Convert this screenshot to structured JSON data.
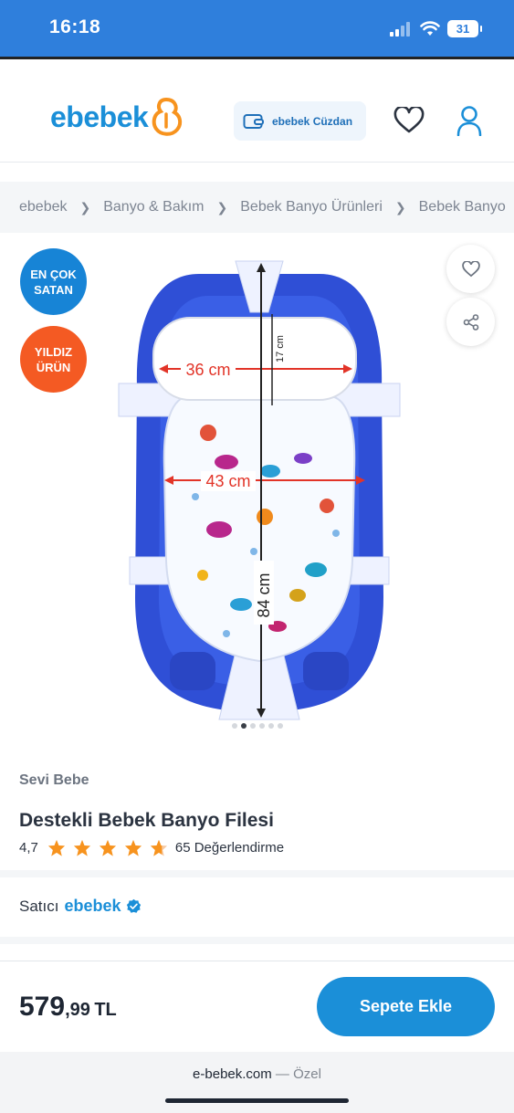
{
  "status": {
    "time": "16:18",
    "battery": "31"
  },
  "header": {
    "logo_text": "ebebek",
    "wallet_label": "ebebek Cüzdan",
    "icons": [
      "heart-icon",
      "user-icon",
      "wallet-icon"
    ]
  },
  "breadcrumb": [
    "ebebek",
    "Banyo & Bakım",
    "Bebek Banyo Ürünleri",
    "Bebek Banyo"
  ],
  "badges": {
    "best_seller_line1": "EN ÇOK",
    "best_seller_line2": "SATAN",
    "star_line1": "YILDIZ",
    "star_line2": "ÜRÜN"
  },
  "image_labels": {
    "width_top": "36 cm",
    "height_pillow": "17 cm",
    "width_mid": "43 cm",
    "length": "84 cm"
  },
  "gallery": {
    "dot_count": 6,
    "active_dot": 2
  },
  "product": {
    "brand": "Sevi Bebe",
    "title": "Destekli Bebek Banyo Filesi",
    "rating": "4,7",
    "rating_value": 4.7,
    "rating_max": 5,
    "reviews": "65 Değerlendirme"
  },
  "seller": {
    "label": "Satıcı",
    "name": "ebebek"
  },
  "purchase": {
    "price_main": "579",
    "price_decimals": ",99",
    "currency": "TL",
    "button_label": "Sepete Ekle"
  },
  "browser": {
    "url": "e-bebek.com",
    "note": " — Özel"
  },
  "colors": {
    "brand_blue": "#1b8fd8",
    "status_blue": "#2f7fdc",
    "badge_orange": "#f45a23",
    "star_orange": "#f7931e"
  }
}
